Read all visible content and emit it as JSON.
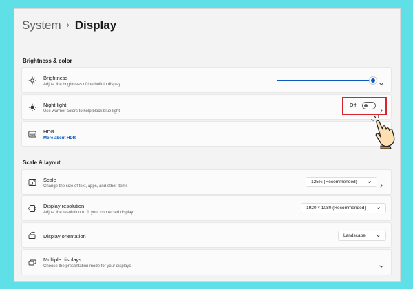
{
  "breadcrumb": {
    "root": "System",
    "separator": "›",
    "current": "Display"
  },
  "sections": {
    "brightness_color": "Brightness & color",
    "scale_layout": "Scale & layout"
  },
  "brightness": {
    "title": "Brightness",
    "desc": "Adjust the brightness of the built-in display",
    "level": 1.0,
    "icon": "sun-icon"
  },
  "night_light": {
    "title": "Night light",
    "desc": "Use warmer colors to help block blue light",
    "state_label": "Off",
    "icon": "sun-dim-icon"
  },
  "hdr": {
    "title": "HDR",
    "link": "More about HDR",
    "icon": "hdr-icon"
  },
  "scale": {
    "title": "Scale",
    "desc": "Change the size of text, apps, and other items",
    "value": "125% (Recommended)",
    "icon": "scale-icon"
  },
  "resolution": {
    "title": "Display resolution",
    "desc": "Adjust the resolution to fit your connected display",
    "value": "1920 × 1080 (Recommended)",
    "icon": "resolution-icon"
  },
  "orientation": {
    "title": "Display orientation",
    "value": "Landscape",
    "icon": "orientation-icon"
  },
  "multiple_displays": {
    "title": "Multiple displays",
    "desc": "Choose the presentation mode for your displays",
    "icon": "multiple-displays-icon"
  },
  "colors": {
    "accent": "#0a5bbf",
    "highlight": "#d9232d",
    "background": "#5fe0e6"
  }
}
